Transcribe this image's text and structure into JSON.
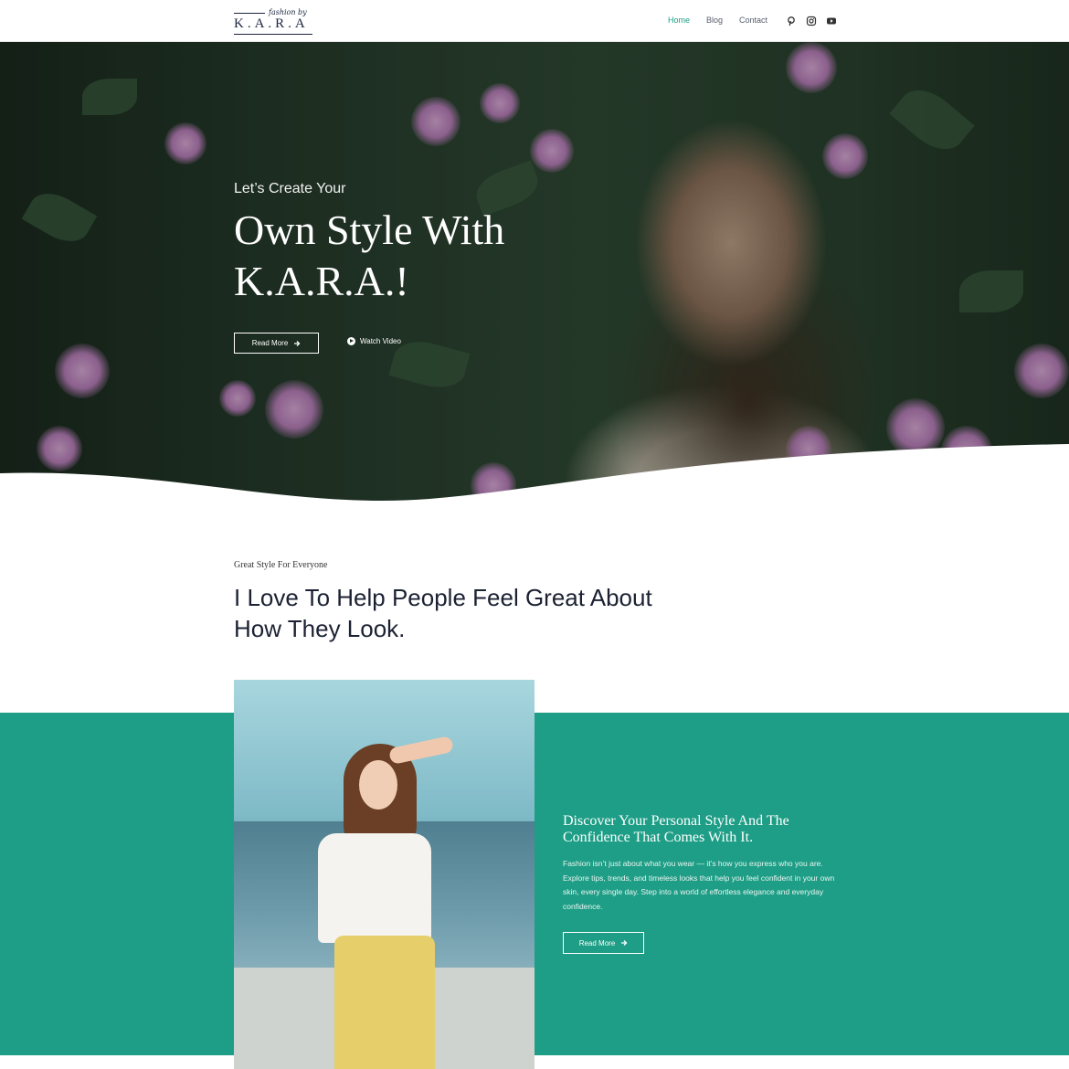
{
  "brand": {
    "script": "fashion by",
    "name": "K.A.R.A"
  },
  "nav": {
    "items": [
      "Home",
      "Blog",
      "Contact"
    ],
    "active": "Home"
  },
  "social": {
    "icons": [
      "pinterest-icon",
      "instagram-icon",
      "youtube-icon"
    ]
  },
  "hero": {
    "subtitle": "Let’s Create Your",
    "title": "Own Style With K.A.R.A.!",
    "read_more": "Read More",
    "watch_video": "Watch Video"
  },
  "intro": {
    "kicker": "Great Style For Everyone",
    "heading": "I Love To Help People Feel Great About How They Look."
  },
  "feature": {
    "title": "Discover Your Personal Style And The Confidence That Comes With It.",
    "text": "Fashion isn’t just about what you wear — it’s how you express who you are. Explore tips, trends, and timeless looks that help you feel confident in your own skin, every single day. Step into a world of effortless elegance and everyday confidence.",
    "read_more": "Read More"
  },
  "colors": {
    "accent": "#1e9e86",
    "nav_active": "#1f9e86",
    "text_dark": "#1c2233"
  }
}
